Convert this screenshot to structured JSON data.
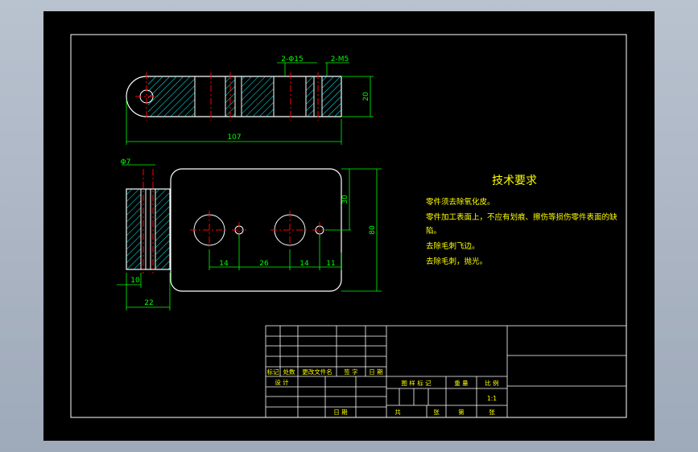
{
  "drawing": {
    "top_dims": {
      "holes_15": "2-Φ15",
      "holes_m5": "2-M5",
      "height": "20",
      "length": "107"
    },
    "front_dims": {
      "pin": "Φ7",
      "width10": "10",
      "width22": "22",
      "h30": "30",
      "h80": "80",
      "d14a": "14",
      "d26": "26",
      "d14b": "14",
      "d11": "11"
    },
    "tech": {
      "title": "技术要求",
      "lines": [
        "零件须去除氧化皮。",
        "零件加工表面上，不应有划痕、擦伤等损伤零件表面的缺",
        "陷。",
        "去除毛刺飞边。",
        "去除毛刺，抛光。"
      ]
    },
    "title_block": {
      "h_mark": "标记",
      "h_count": "处数",
      "h_file": "更改文件名",
      "h_sign": "签 字",
      "h_date": "日 期",
      "design": "设 计",
      "date": "日 期",
      "stage_label": "图 样 标 记",
      "weight": "重 量",
      "scale": "比 例",
      "scale_value": "1:1",
      "total": "共",
      "sheet_word1": "张",
      "page": "第",
      "sheet_word2": "张"
    }
  },
  "colors": {
    "background": "#000000",
    "frame": "#ffffff",
    "outline": "#ffffff",
    "dimension": "#00ff00",
    "center": "#ff0000",
    "hatch": "#00ffff",
    "text": "#ffff00"
  }
}
